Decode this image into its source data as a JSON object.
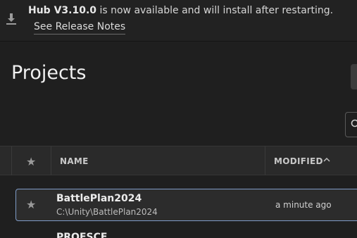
{
  "banner": {
    "version_label": "Hub V3.10.0",
    "message": " is now available and will install after restarting.",
    "release_notes_link": "See Release Notes"
  },
  "page": {
    "title": "Projects"
  },
  "table": {
    "columns": {
      "name": "NAME",
      "modified": "MODIFIED"
    },
    "sort": {
      "column": "modified",
      "direction": "ascending"
    },
    "rows": [
      {
        "name": "BattlePlan2024",
        "path": "C:\\Unity\\BattlePlan2024",
        "modified": "a minute ago",
        "starred": false,
        "selected": true
      },
      {
        "name": "PROFSCE"
      }
    ]
  },
  "colors": {
    "accent_border": "#7f9bc7",
    "background": "#1f1f1f"
  }
}
